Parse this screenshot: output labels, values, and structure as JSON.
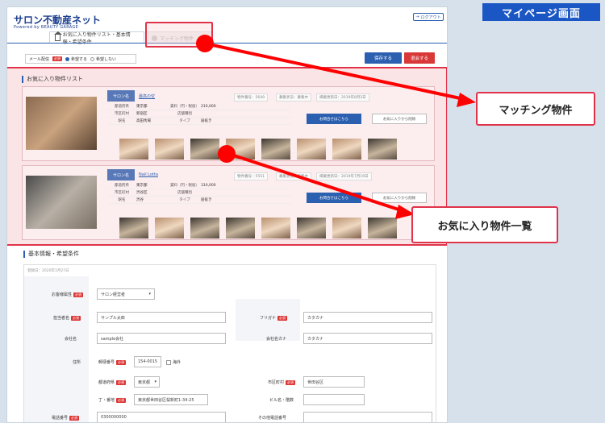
{
  "page_label": "マイページ画面",
  "header": {
    "logo_main": "サロン不動産ネット",
    "logo_sub": "Powered by  BEAUTY GARAGE",
    "logout": "ログアウト"
  },
  "tabs": [
    {
      "label": "お気に入り物件リスト・基本情報・希望条件"
    },
    {
      "label": "マッチング物件"
    }
  ],
  "mail": {
    "label": "メール配信",
    "required": "必須",
    "option_on": "希望する",
    "option_off": "希望しない"
  },
  "actions": {
    "save": "保存する",
    "quit": "退会する"
  },
  "favorites": {
    "title": "お気に入り物件リスト",
    "tag": "サロン名",
    "labels": {
      "use": "都道府県",
      "city": "市区町村",
      "station": "駅名",
      "rent": "賃料（円・税抜）",
      "store_type": "店舗種別",
      "type": "タイプ",
      "inquiry": "お問合せはこちら",
      "remove": "お気に入りから削除"
    },
    "items": [
      {
        "name": "最高の空",
        "number": "物件番号：5649",
        "status": "募集状況：募集中",
        "updated": "掲載更新日：2019年8月2日",
        "pref": "東京都",
        "city": "新宿区",
        "station": "高田馬場",
        "rent": "210,000",
        "store_type": "",
        "type": "居抜き"
      },
      {
        "name": "Nail Lotta",
        "number": "物件番号：5551",
        "status": "募集状況：募集中",
        "updated": "掲載更新日：2019年7月19日",
        "pref": "東京都",
        "city": "渋谷区",
        "station": "渋谷",
        "rent": "310,000",
        "store_type": "",
        "type": "居抜き"
      }
    ]
  },
  "basic": {
    "title": "基本情報・希望条件",
    "reg_date": "登録日：2020年1月27日",
    "required": "必須",
    "fields": {
      "business_label": "お客様属性",
      "business_value": "サロン経営者",
      "name_label": "担当者名",
      "name_value": "サンプル太郎",
      "kana_label": "フリガナ",
      "kana_value": "カタカナ",
      "company_label": "会社名",
      "company_value": "sample会社",
      "company_kana_label": "会社名カナ",
      "company_kana_value": "カタカナ",
      "address_label": "住所",
      "zip_label": "郵便番号",
      "zip_value": "154-0015",
      "overseas_label": "海外",
      "pref_label": "都道府県",
      "pref_value": "東京都",
      "city_label": "市区町村",
      "city_value": "世田谷区",
      "street_label": "丁・番地",
      "street_value": "東京都世田谷区桜新町1-34-25",
      "building_label": "ビル名・階数",
      "phone_label": "電話番号",
      "phone_value": "0300000000",
      "other_phone_label": "その他電話番号"
    }
  },
  "callouts": {
    "matching": "マッチング物件",
    "favorites": "お気に入り物件一覧"
  },
  "colors": {
    "brand": "#1a56c4",
    "highlight": "#e0334a",
    "save": "#2b5fb0",
    "quit": "#d93838"
  }
}
